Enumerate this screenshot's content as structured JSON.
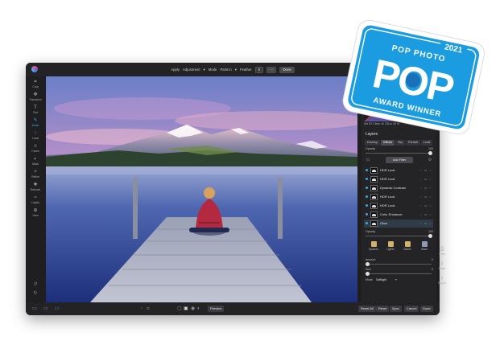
{
  "toolbar": {
    "apply_label": "Apply",
    "apply_value": "Adjustment",
    "mode_label": "Mode",
    "mode_value": "Paint in",
    "feather_label": "Feather",
    "feather_value": "5",
    "more_label": "···",
    "done_label": "Done"
  },
  "tools": [
    {
      "label": "Crop",
      "icon": "crop-icon"
    },
    {
      "label": "Transform",
      "icon": "transform-icon"
    },
    {
      "label": "Text",
      "icon": "text-icon"
    },
    {
      "label": "Brush",
      "icon": "brush-icon"
    },
    {
      "label": "Local",
      "icon": "local-icon"
    },
    {
      "label": "Faces",
      "icon": "faces-icon"
    },
    {
      "label": "Mask",
      "icon": "mask-icon"
    },
    {
      "label": "Refine",
      "icon": "refine-icon"
    },
    {
      "label": "Retouch",
      "icon": "retouch-icon"
    },
    {
      "label": "Liquify",
      "icon": "liquify-icon"
    },
    {
      "label": "View",
      "icon": "view-icon"
    }
  ],
  "panel": {
    "histogram_info": "Std  R2  Clean  40  CBLur  60  In",
    "title": "Layers",
    "tabs": [
      "Develop",
      "Effects",
      "Sky",
      "Portrait",
      "Local"
    ],
    "opacity_label": "Opacity",
    "opacity_value": "100",
    "add_filter_label": "Add Filter",
    "layers": [
      "HDR Look",
      "HDR Look",
      "Dynamic Contrast",
      "HDR Look",
      "HDR Look",
      "Color Enhancer",
      "Glow"
    ],
    "opacity2_label": "Opacity",
    "opacity2_value": "100",
    "modes": [
      "Spanner",
      "Lighter",
      "Darker",
      "Wave"
    ],
    "amount_label": "Amount",
    "amount_value": "0",
    "size_label": "Size",
    "size_value": "0",
    "blend_label": "Mode",
    "blend_value": "Softlight",
    "shared_opacity": 0.8
  },
  "right_tools": [
    {
      "label": "Print",
      "icon": "print-icon"
    },
    {
      "label": "Share",
      "icon": "share-icon"
    },
    {
      "label": "Export",
      "icon": "export-icon"
    }
  ],
  "bottom": {
    "preview_label": "Preview",
    "reset_all_label": "Reset All",
    "reset_label": "Reset",
    "sync_label": "Sync",
    "cancel_label": "Cancel",
    "done_label": "Done"
  },
  "badge": {
    "year": "2021",
    "top_text": "POP PHOTO",
    "big_text": "POP",
    "bottom_text": "AWARD WINNER"
  },
  "colors": {
    "accent": "#3aa7e8",
    "badge_blue": "#1b9be0",
    "window_bg": "#1f1f21"
  }
}
